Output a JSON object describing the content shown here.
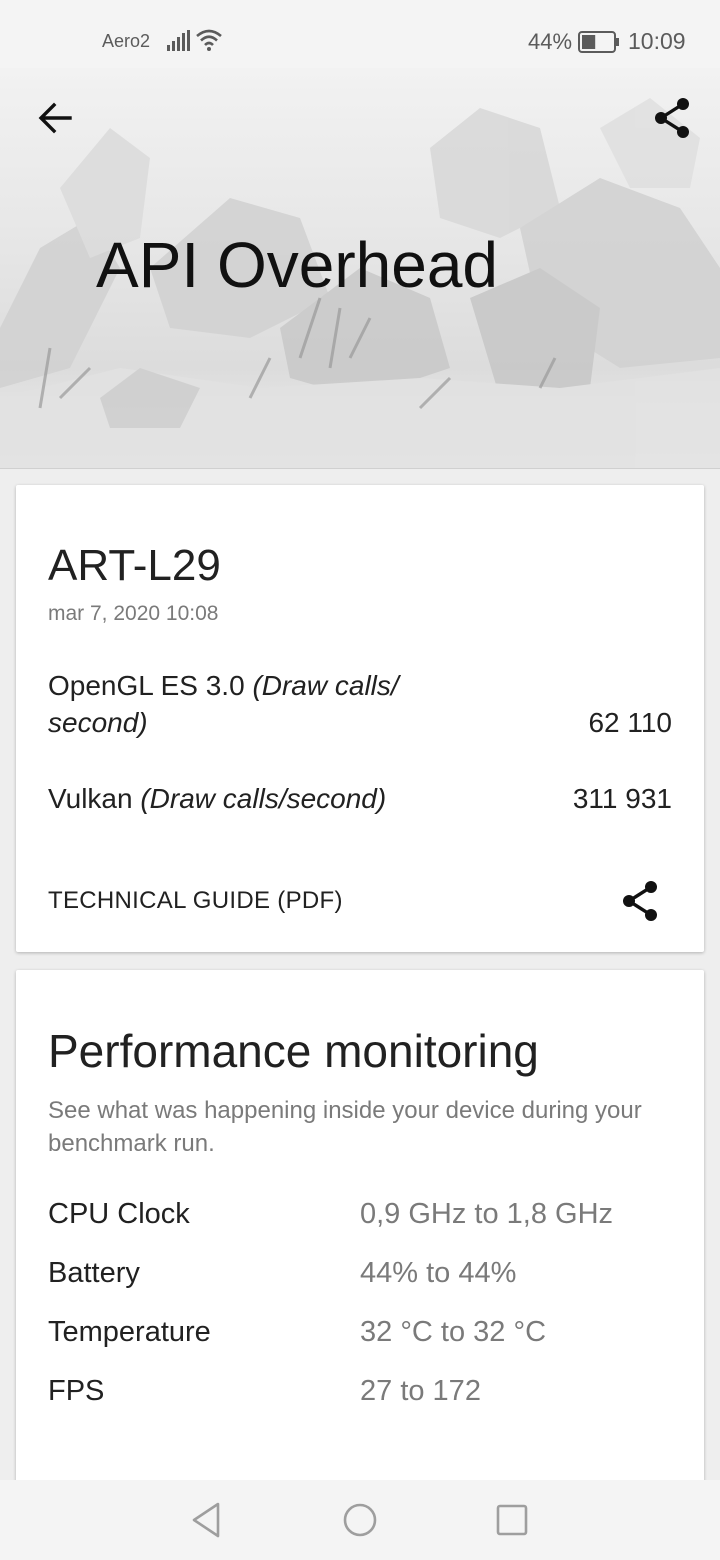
{
  "status_bar": {
    "carrier": "Aero2",
    "battery_percent": "44%",
    "battery_level": 0.44,
    "time": "10:09",
    "icons": [
      "signal-icon",
      "wifi-icon",
      "battery-icon"
    ]
  },
  "header": {
    "title": "API Overhead",
    "back_icon": "arrow-left-icon",
    "share_icon": "share-icon"
  },
  "result": {
    "device_name": "ART-L29",
    "date": "mar 7, 2020 10:08",
    "scores": [
      {
        "name": "OpenGL ES 3.0",
        "unit": "(Draw calls/ second)",
        "value": "62 110"
      },
      {
        "name": "Vulkan",
        "unit": "(Draw calls/second)",
        "value": "311 931"
      }
    ],
    "technical_guide_label": "TECHNICAL GUIDE (PDF)",
    "share_icon": "share-icon"
  },
  "performance": {
    "title": "Performance monitoring",
    "description": "See what was happening inside your device during your benchmark run.",
    "metrics": [
      {
        "label": "CPU Clock",
        "value": "0,9 GHz to 1,8 GHz"
      },
      {
        "label": "Battery",
        "value": "44% to 44%"
      },
      {
        "label": "Temperature",
        "value": "32 °C to 32 °C"
      },
      {
        "label": "FPS",
        "value": "27 to 172"
      }
    ]
  },
  "nav_bar": {
    "icons": [
      "nav-back-triangle-icon",
      "nav-home-circle-icon",
      "nav-recents-square-icon"
    ]
  },
  "colors": {
    "background": "#eeeeee",
    "card": "#ffffff",
    "primary_text": "#212121",
    "secondary_text": "#7a7a7a",
    "status_text": "#5b5b5b"
  }
}
